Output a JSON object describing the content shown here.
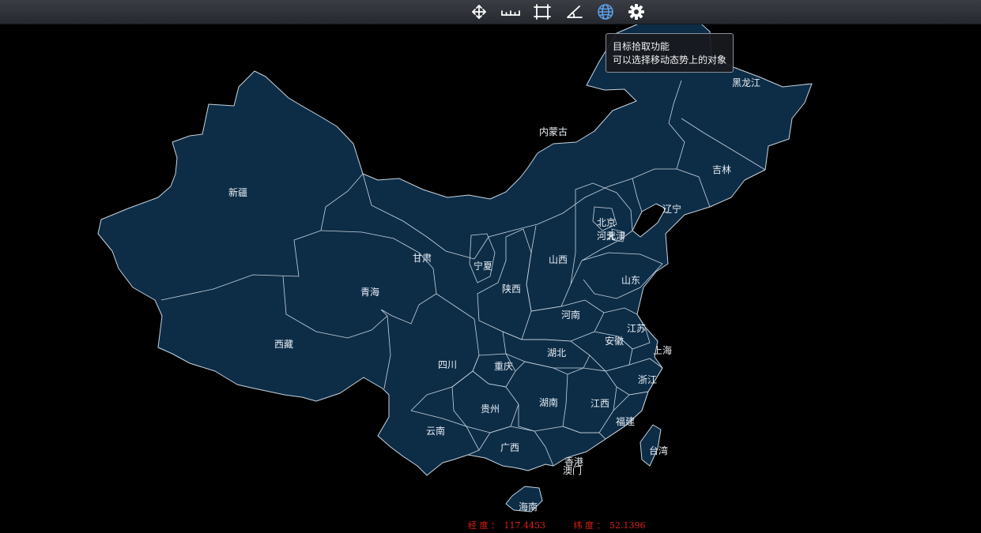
{
  "colors": {
    "background": "#000000",
    "land": "#0d2d47",
    "border": "#c8d4de",
    "coord_text": "#e0201a",
    "globe_active": "#5aa0e6"
  },
  "toolbar": {
    "tools": [
      {
        "name": "pan",
        "icon": "move-arrows-icon"
      },
      {
        "name": "measure-distance",
        "icon": "ruler-icon"
      },
      {
        "name": "measure-area",
        "icon": "crop-rectangle-icon"
      },
      {
        "name": "measure-angle",
        "icon": "angle-icon"
      },
      {
        "name": "pick-target",
        "icon": "globe-icon",
        "active": true
      },
      {
        "name": "settings",
        "icon": "gear-icon"
      }
    ]
  },
  "tooltip": {
    "line1": "目标拾取功能",
    "line2": "可以选择移动态势上的对象"
  },
  "provinces": {
    "heilongjiang": "黑龙江",
    "neimenggu": "内蒙古",
    "jilin": "吉林",
    "liaoning": "辽宁",
    "beijing": "北京",
    "tianjin": "天津",
    "hebei": "河北",
    "xinjiang": "新疆",
    "gansu": "甘肃",
    "ningxia": "宁夏",
    "shanxi": "山西",
    "shandong": "山东",
    "qinghai": "青海",
    "shaanxi": "陕西",
    "henan": "河南",
    "jiangsu": "江苏",
    "anhui": "安徽",
    "shanghai": "上海",
    "xizang": "西藏",
    "hubei": "湖北",
    "sichuan": "四川",
    "chongqing": "重庆",
    "zhejiang": "浙江",
    "guizhou": "贵州",
    "hunan": "湖南",
    "jiangxi": "江西",
    "fujian": "福建",
    "yunnan": "云南",
    "guangxi": "广西",
    "taiwan": "台湾",
    "xianggang": "香港",
    "aomen": "澳门",
    "hainan": "海南"
  },
  "coords": {
    "lon_label": "经 度 ：",
    "lon_value": "117.4453",
    "lat_label": "纬 度 ：",
    "lat_value": "52.1396"
  }
}
